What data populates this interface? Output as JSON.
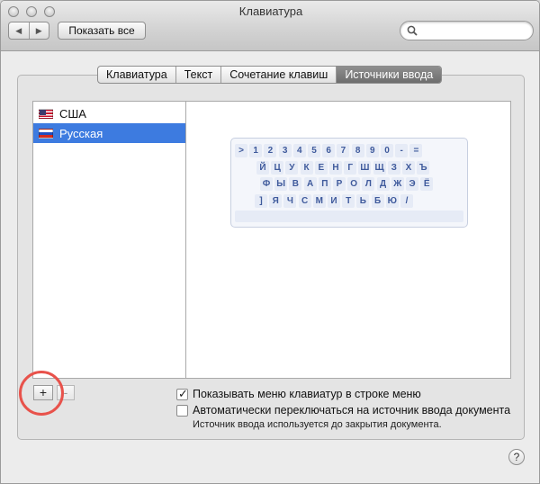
{
  "window": {
    "title": "Клавиатура"
  },
  "toolbar": {
    "back_glyph": "◀",
    "forward_glyph": "▶",
    "show_all_label": "Показать все"
  },
  "search": {
    "placeholder": "",
    "value": ""
  },
  "tabs": [
    {
      "label": "Клавиатура",
      "active": false
    },
    {
      "label": "Текст",
      "active": false
    },
    {
      "label": "Сочетание клавиш",
      "active": false
    },
    {
      "label": "Источники ввода",
      "active": true
    }
  ],
  "sources": [
    {
      "label": "США",
      "flag": "us-flag-icon",
      "selected": false
    },
    {
      "label": "Русская",
      "flag": "ru-flag-icon",
      "selected": true
    }
  ],
  "keyboard_preview": {
    "rows": [
      [
        ">",
        "1",
        "2",
        "3",
        "4",
        "5",
        "6",
        "7",
        "8",
        "9",
        "0",
        "-",
        "="
      ],
      [
        "Й",
        "Ц",
        "У",
        "К",
        "Е",
        "Н",
        "Г",
        "Ш",
        "Щ",
        "З",
        "Х",
        "Ъ"
      ],
      [
        "Ф",
        "Ы",
        "В",
        "А",
        "П",
        "Р",
        "О",
        "Л",
        "Д",
        "Ж",
        "Э",
        "Ё"
      ],
      [
        "]",
        "Я",
        "Ч",
        "С",
        "М",
        "И",
        "Т",
        "Ь",
        "Б",
        "Ю",
        "/"
      ]
    ]
  },
  "list_controls": {
    "add_label": "+",
    "remove_label": "-"
  },
  "options": {
    "show_menu": {
      "label": "Показывать меню клавиатур в строке меню",
      "checked": true
    },
    "auto_switch": {
      "label": "Автоматически переключаться на источник ввода документа",
      "checked": false
    },
    "note": "Источник ввода используется до закрытия документа."
  },
  "help_label": "?",
  "colors": {
    "selection": "#3d7be0",
    "annotation_circle": "#e8524b",
    "key_text": "#3f5a9c"
  }
}
